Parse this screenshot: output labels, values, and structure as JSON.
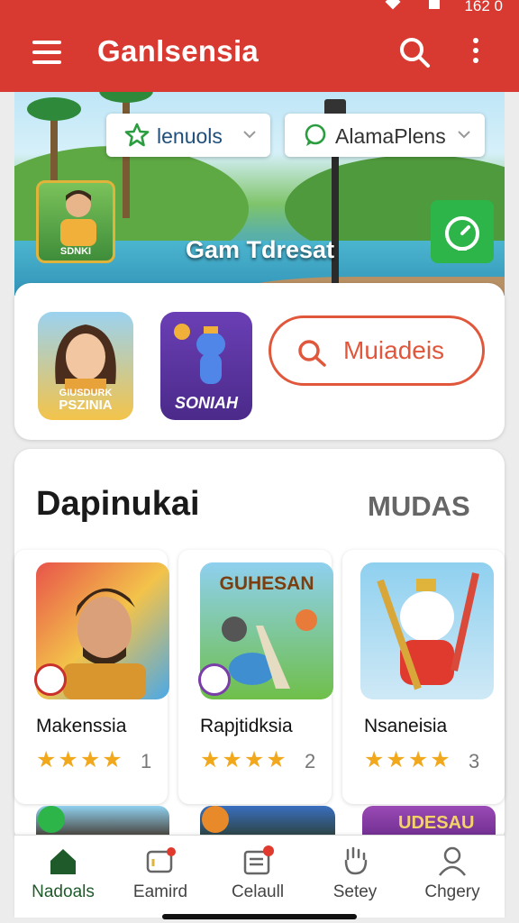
{
  "status": {
    "time": "162 0"
  },
  "app": {
    "title": "Ganlsensia"
  },
  "hero": {
    "filter_left": "lenuols",
    "filter_right": "AlamaPlens",
    "caption": "Gam Tdresat",
    "player_label": "SDNKI"
  },
  "quick": {
    "tile1_label": "PSZINIA",
    "tile1_sub": "GIUSDURK",
    "tile2_label": "SONIAH",
    "button_label": "Muiadeis"
  },
  "section": {
    "title": "Dapinukai",
    "more": "MUDAS"
  },
  "games": [
    {
      "name": "Makenssia",
      "stars": "★★★★",
      "count": "1"
    },
    {
      "name": "Rapjtidksia",
      "stars": "★★★★",
      "count": "2",
      "banner": "GUHESAN"
    },
    {
      "name": "Nsaneisia",
      "stars": "★★★★",
      "count": "3"
    }
  ],
  "peek": {
    "banner": "UDESAU"
  },
  "nav": [
    {
      "label": "Nadoals",
      "active": true
    },
    {
      "label": "Eamird"
    },
    {
      "label": "Celaull"
    },
    {
      "label": "Setey"
    },
    {
      "label": "Chgery"
    }
  ],
  "colors": {
    "brand_red": "#d83a31",
    "accent_orange": "#e0573c",
    "active_green": "#1f5b2a",
    "star": "#f2a81c"
  }
}
